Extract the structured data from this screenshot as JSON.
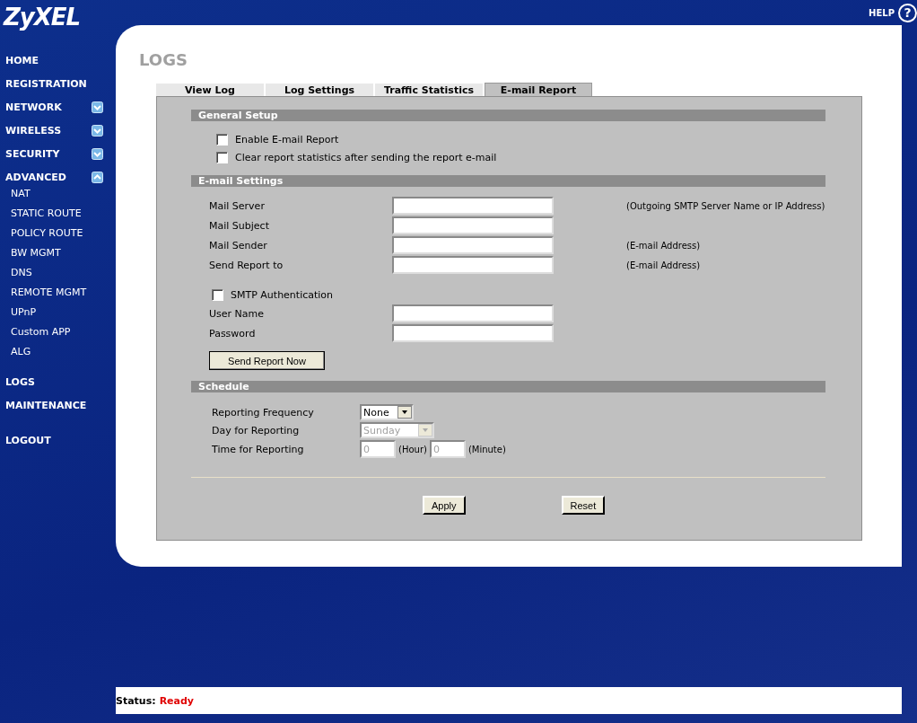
{
  "brand": {
    "logo": "ZyXEL"
  },
  "help": {
    "label": "HELP",
    "icon_text": "?"
  },
  "sidebar": {
    "items": [
      {
        "label": "HOME",
        "kind": "link"
      },
      {
        "label": "REGISTRATION",
        "kind": "link"
      },
      {
        "label": "NETWORK",
        "kind": "menu",
        "expanded": false
      },
      {
        "label": "WIRELESS",
        "kind": "menu",
        "expanded": false
      },
      {
        "label": "SECURITY",
        "kind": "menu",
        "expanded": false
      },
      {
        "label": "ADVANCED",
        "kind": "menu",
        "expanded": true,
        "children": [
          {
            "label": "NAT"
          },
          {
            "label": "STATIC ROUTE"
          },
          {
            "label": "POLICY ROUTE"
          },
          {
            "label": "BW MGMT"
          },
          {
            "label": "DNS"
          },
          {
            "label": "REMOTE MGMT"
          },
          {
            "label": "UPnP"
          },
          {
            "label": "Custom APP"
          },
          {
            "label": "ALG"
          }
        ]
      },
      {
        "label": "LOGS",
        "kind": "link"
      },
      {
        "label": "MAINTENANCE",
        "kind": "link"
      }
    ],
    "logout": "LOGOUT"
  },
  "page_title": "LOGS",
  "tabs": [
    {
      "label": "View Log",
      "selected": false
    },
    {
      "label": "Log Settings",
      "selected": false
    },
    {
      "label": "Traffic Statistics",
      "selected": false
    },
    {
      "label": "E-mail Report",
      "selected": true
    }
  ],
  "general_setup": {
    "title": "General Setup",
    "options": [
      {
        "label": "Enable E-mail Report",
        "checked": false
      },
      {
        "label": "Clear report statistics after sending the report e-mail",
        "checked": false
      }
    ]
  },
  "email_settings": {
    "title": "E-mail Settings",
    "fields": [
      {
        "label": "Mail Server",
        "hint": "(Outgoing SMTP Server Name or IP Address)"
      },
      {
        "label": "Mail Subject"
      },
      {
        "label": "Mail Sender",
        "hint": "(E-mail Address)"
      },
      {
        "label": "Send Report to",
        "hint": "(E-mail Address)"
      }
    ],
    "smtp_auth": {
      "label": "SMTP Authentication",
      "checked": false
    },
    "auth_fields": [
      {
        "label": "User Name"
      },
      {
        "label": "Password"
      }
    ],
    "send_button": "Send Report Now"
  },
  "schedule": {
    "title": "Schedule",
    "frequency": {
      "label": "Reporting Frequency",
      "value": "None",
      "disabled": false
    },
    "day": {
      "label": "Day for Reporting",
      "value": "Sunday",
      "disabled": true
    },
    "time": {
      "label": "Time for Reporting",
      "hour": "0",
      "hour_unit": "(Hour)",
      "minute": "0",
      "minute_unit": "(Minute)",
      "disabled": true
    }
  },
  "buttons": [
    "Apply",
    "Reset"
  ],
  "status_bar": {
    "label": "Status:",
    "value": "Ready"
  }
}
